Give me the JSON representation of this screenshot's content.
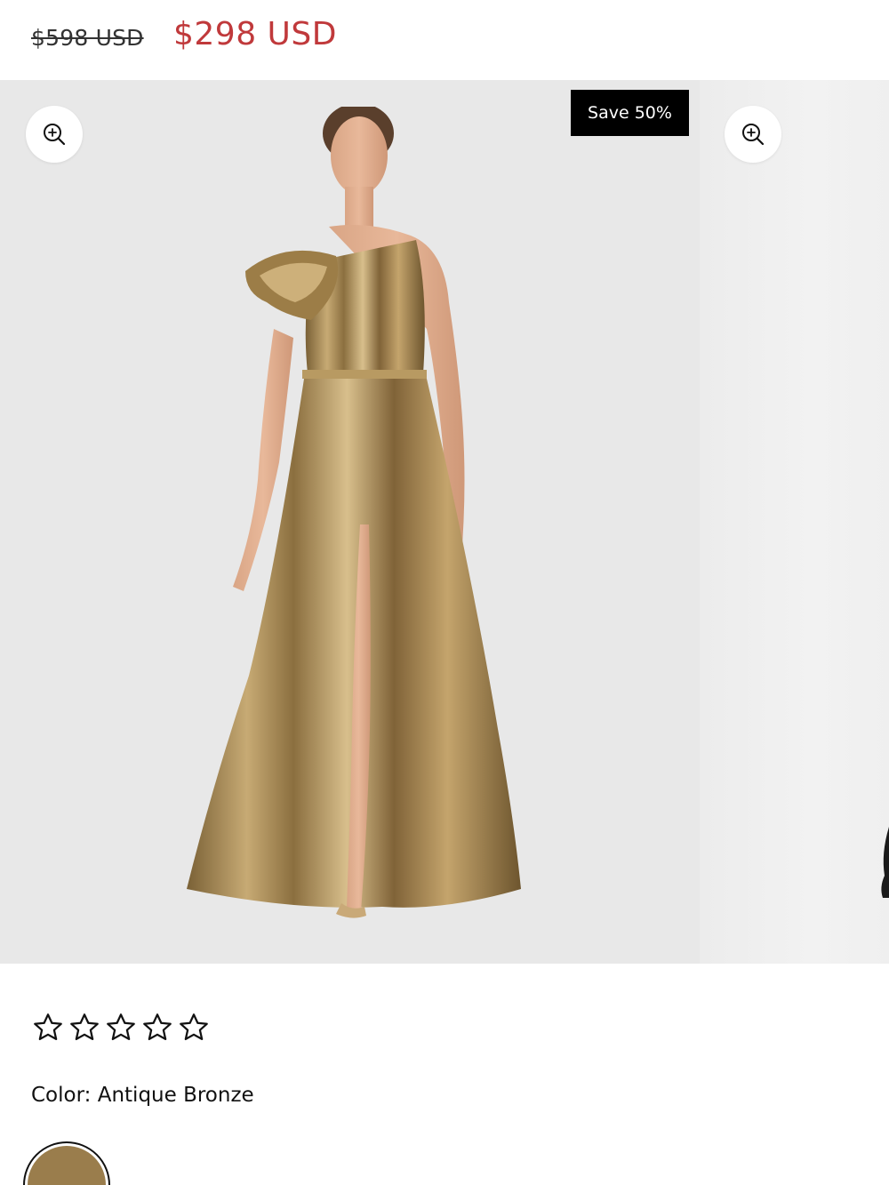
{
  "price": {
    "original": "$598 USD",
    "sale": "$298 USD"
  },
  "gallery": {
    "badge": "Save 50%",
    "icons": {
      "zoom": "zoom-in-icon"
    },
    "images": [
      {
        "alt": "Model wearing a one-shoulder metallic bronze gown with ruffle shoulder and front slit"
      },
      {
        "alt": "Next product image"
      }
    ]
  },
  "rating": {
    "stars_filled": 0,
    "stars_total": 5
  },
  "color": {
    "label": "Color:",
    "value": "Antique Bronze",
    "swatch_hex": "#9a7d4c"
  },
  "colors": {
    "sale_price": "#c0393b",
    "badge_bg": "#000000",
    "gallery_bg": "#e8e8e8"
  }
}
